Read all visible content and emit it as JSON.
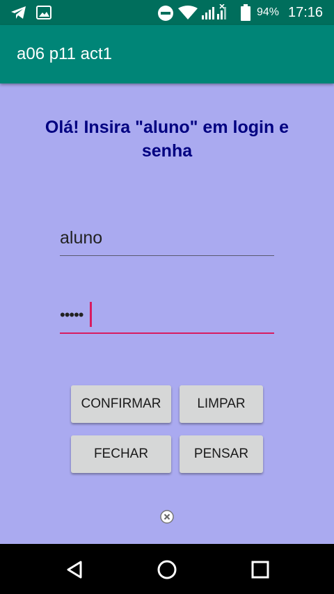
{
  "status_bar": {
    "battery_percent": "94%",
    "time": "17:16",
    "icons": [
      "telegram-icon",
      "gallery-icon",
      "do-not-disturb-icon",
      "wifi-icon",
      "signal-icon",
      "battery-icon"
    ]
  },
  "app_bar": {
    "title": "a06 p11 act1"
  },
  "main": {
    "prompt": "Olá! Insira \"aluno\" em login e senha",
    "login_value": "aluno",
    "password_mask": "•••••",
    "buttons": {
      "confirmar": "CONFIRMAR",
      "limpar": "LIMPAR",
      "fechar": "FECHAR",
      "pensar": "PENSAR"
    }
  },
  "nav_bar": {
    "icons": [
      "back-icon",
      "home-icon",
      "recents-icon"
    ]
  },
  "colors": {
    "status_bar": "#006e5c",
    "app_bar": "#008577",
    "background": "#aaaaf0",
    "prompt_text": "#000080",
    "accent": "#d81b60",
    "button": "#d6d7d7"
  }
}
